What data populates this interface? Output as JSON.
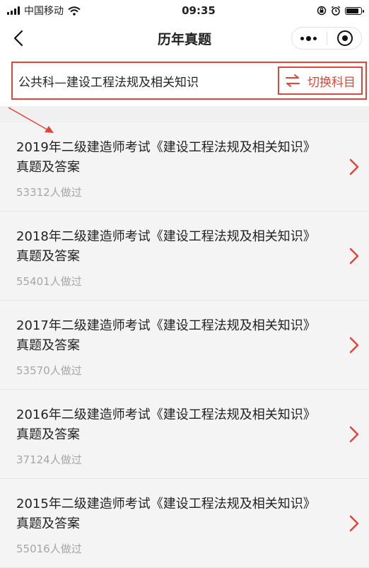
{
  "status_bar": {
    "carrier": "中国移动",
    "time": "09:35"
  },
  "nav": {
    "title": "历年真题"
  },
  "subject": {
    "name": "公共科—建设工程法规及相关知识",
    "switch_label": "切换科目"
  },
  "accent_color": "#e0453a",
  "papers": [
    {
      "title": "2019年二级建造师考试《建设工程法规及相关知识》真题及答案",
      "count": "53312人做过"
    },
    {
      "title": "2018年二级建造师考试《建设工程法规及相关知识》真题及答案",
      "count": "55401人做过"
    },
    {
      "title": "2017年二级建造师考试《建设工程法规及相关知识》真题及答案",
      "count": "53570人做过"
    },
    {
      "title": "2016年二级建造师考试《建设工程法规及相关知识》真题及答案",
      "count": "37124人做过"
    },
    {
      "title": "2015年二级建造师考试《建设工程法规及相关知识》真题及答案",
      "count": "55016人做过"
    }
  ]
}
